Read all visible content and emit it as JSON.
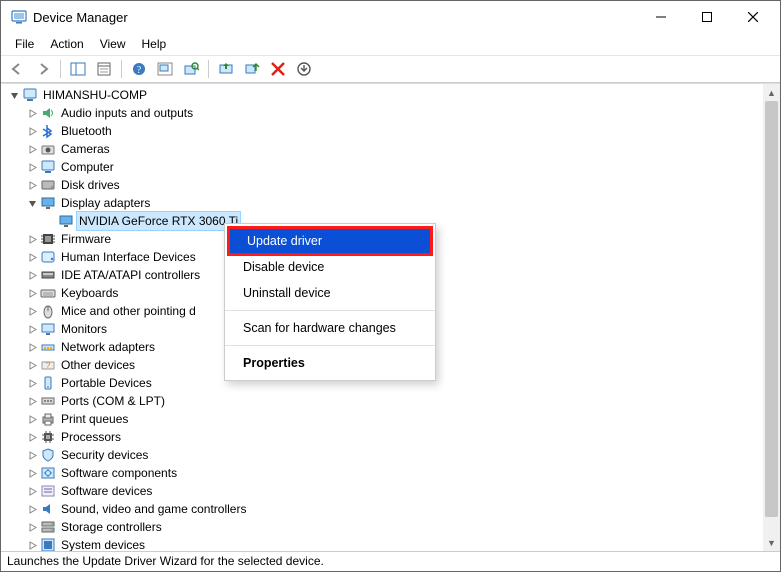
{
  "title": "Device Manager",
  "menu": {
    "file": "File",
    "action": "Action",
    "view": "View",
    "help": "Help"
  },
  "root": "HIMANSHU-COMP",
  "categories": [
    "Audio inputs and outputs",
    "Bluetooth",
    "Cameras",
    "Computer",
    "Disk drives",
    "Display adapters",
    "Firmware",
    "Human Interface Devices",
    "IDE ATA/ATAPI controllers",
    "Keyboards",
    "Mice and other pointing d",
    "Monitors",
    "Network adapters",
    "Other devices",
    "Portable Devices",
    "Ports (COM & LPT)",
    "Print queues",
    "Processors",
    "Security devices",
    "Software components",
    "Software devices",
    "Sound, video and game controllers",
    "Storage controllers",
    "System devices"
  ],
  "display_child": "NVIDIA GeForce RTX 3060 Ti",
  "context": {
    "update": "Update driver",
    "disable": "Disable device",
    "uninstall": "Uninstall device",
    "scan": "Scan for hardware changes",
    "properties": "Properties"
  },
  "status": "Launches the Update Driver Wizard for the selected device."
}
